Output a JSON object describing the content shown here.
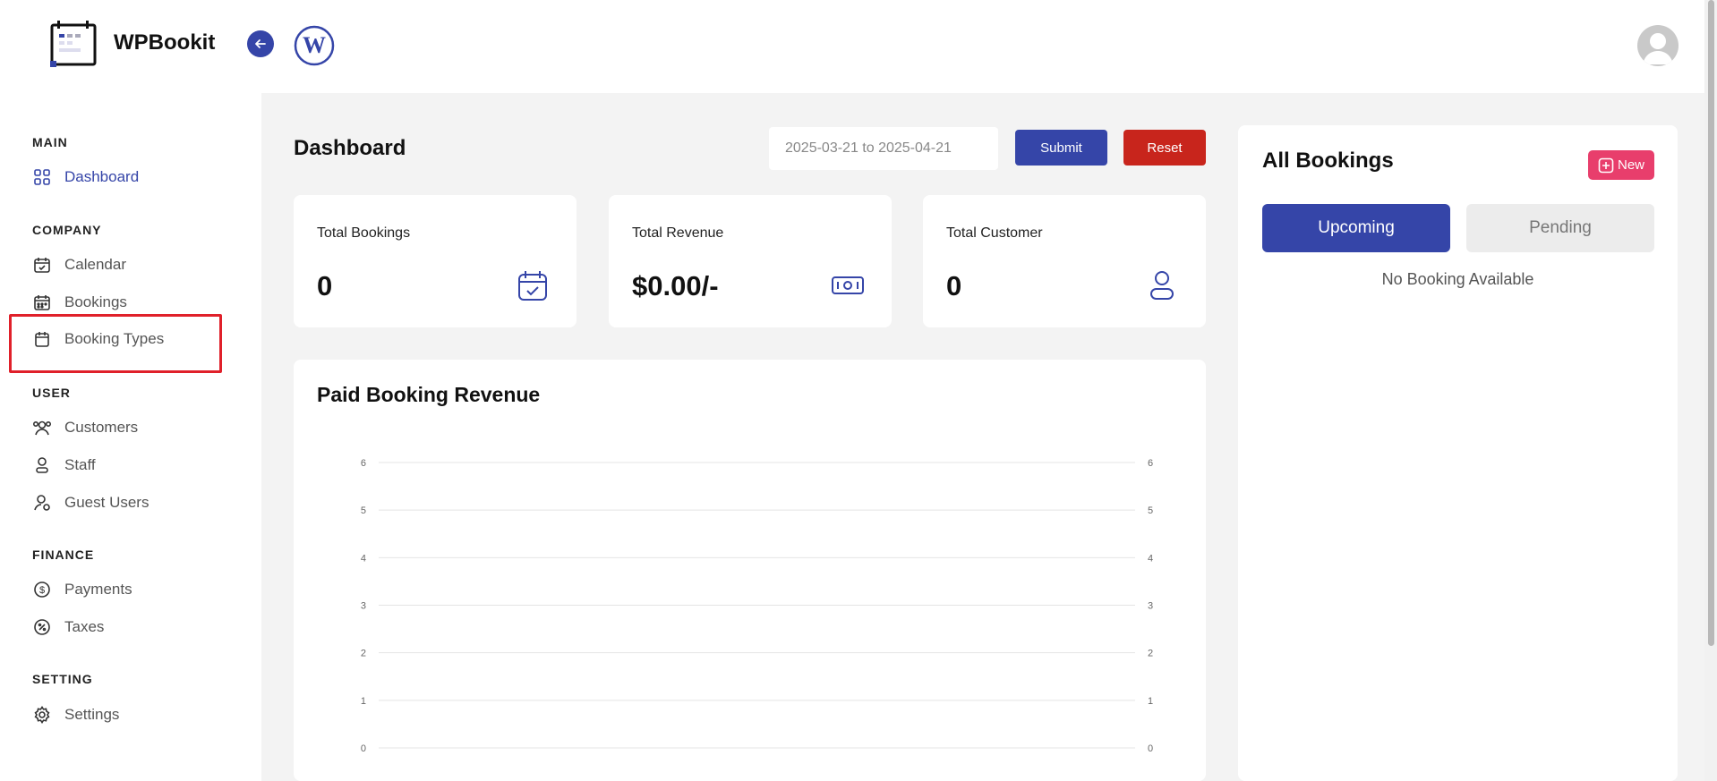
{
  "header": {
    "brand_name": "WPBookit",
    "collapse_icon": "arrow-left-icon",
    "wp_icon": "wordpress-icon",
    "avatar_icon": "user-avatar-icon"
  },
  "sidebar": {
    "sections": {
      "main": "MAIN",
      "company": "COMPANY",
      "user": "USER",
      "finance": "FINANCE",
      "setting": "SETTING"
    },
    "items": {
      "dashboard": "Dashboard",
      "calendar": "Calendar",
      "bookings": "Bookings",
      "booking_types": "Booking Types",
      "customers": "Customers",
      "staff": "Staff",
      "guest_users": "Guest Users",
      "payments": "Payments",
      "taxes": "Taxes",
      "settings": "Settings"
    },
    "active": "dashboard",
    "highlighted": "booking_types"
  },
  "main": {
    "title": "Dashboard",
    "date_range_value": "2025-03-21 to 2025-04-21",
    "submit_label": "Submit",
    "reset_label": "Reset"
  },
  "stats": {
    "total_bookings_label": "Total Bookings",
    "total_bookings_value": "0",
    "total_revenue_label": "Total Revenue",
    "total_revenue_value": "$0.00/-",
    "total_customer_label": "Total Customer",
    "total_customer_value": "0"
  },
  "chart_data": {
    "type": "line",
    "title": "Paid Booking Revenue",
    "xlabel": "",
    "ylabel": "",
    "ylim": [
      0,
      6
    ],
    "y_ticks": [
      0,
      1,
      2,
      3,
      4,
      5,
      6
    ],
    "y2_ticks": [
      0,
      1,
      2,
      3,
      4,
      5,
      6
    ],
    "grid": true,
    "series": []
  },
  "bookings": {
    "title": "All Bookings",
    "new_label": "New",
    "tabs": [
      "Upcoming",
      "Pending"
    ],
    "active_tab": "Upcoming",
    "empty_message": "No Booking Available"
  },
  "colors": {
    "primary": "#3545a8",
    "danger": "#c8251c",
    "accent_pink": "#e83e6c",
    "highlight_red": "#e0202a"
  }
}
